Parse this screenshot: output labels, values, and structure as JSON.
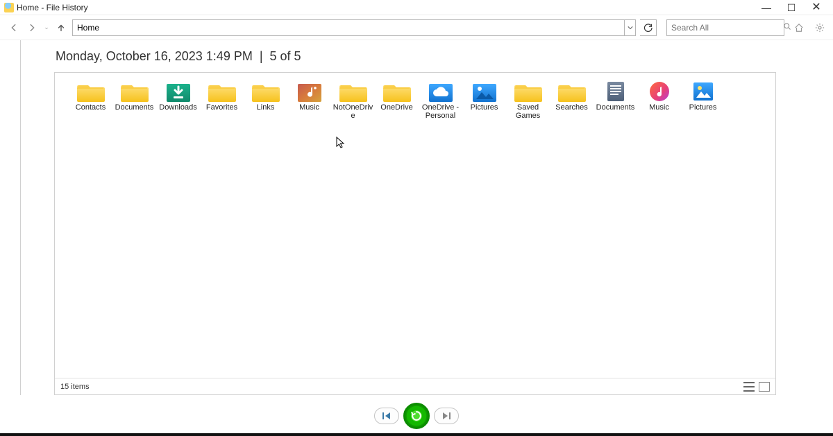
{
  "window": {
    "title": "Home - File History"
  },
  "address": {
    "value": "Home"
  },
  "search": {
    "placeholder": "Search All"
  },
  "heading": {
    "date": "Monday, October 16, 2023 1:49 PM",
    "sep": "|",
    "counter": "5 of 5"
  },
  "items": [
    {
      "label": "Contacts",
      "type": "folder"
    },
    {
      "label": "Documents",
      "type": "folder"
    },
    {
      "label": "Downloads",
      "type": "downloads"
    },
    {
      "label": "Favorites",
      "type": "folder"
    },
    {
      "label": "Links",
      "type": "folder"
    },
    {
      "label": "Music",
      "type": "music-folder"
    },
    {
      "label": "NotOneDrive",
      "type": "folder"
    },
    {
      "label": "OneDrive",
      "type": "folder"
    },
    {
      "label": "OneDrive - Personal",
      "type": "onedrive"
    },
    {
      "label": "Pictures",
      "type": "pictures"
    },
    {
      "label": "Saved Games",
      "type": "folder"
    },
    {
      "label": "Searches",
      "type": "folder"
    },
    {
      "label": "Documents",
      "type": "lib-doc"
    },
    {
      "label": "Music",
      "type": "lib-music"
    },
    {
      "label": "Pictures",
      "type": "lib-pic"
    }
  ],
  "status": {
    "count": "15 items"
  }
}
